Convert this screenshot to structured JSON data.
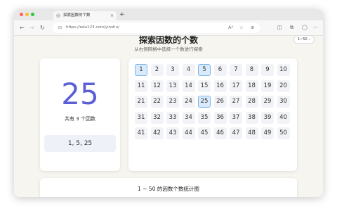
{
  "browser": {
    "tab_title": "探索因数的个数",
    "tab_close": "×",
    "new_tab": "+",
    "url": "https://edu123.com/yinshu/",
    "traffic_colors": [
      "#ff5f57",
      "#febc2e",
      "#28c840"
    ]
  },
  "header": {
    "title": "探索因数的个数",
    "subtitle": "从右侧网格中选择一个数进行探索",
    "range_label": "1~50"
  },
  "selected": {
    "number": "25",
    "count_text": "共有 3 个因数",
    "factors_text": "1, 5, 25",
    "accent": "#5b5fd6"
  },
  "grid": {
    "columns": 10,
    "numbers": [
      "1",
      "2",
      "3",
      "4",
      "5",
      "6",
      "7",
      "8",
      "9",
      "10",
      "11",
      "12",
      "13",
      "14",
      "15",
      "16",
      "17",
      "18",
      "19",
      "20",
      "21",
      "22",
      "23",
      "24",
      "25",
      "26",
      "27",
      "28",
      "29",
      "30",
      "31",
      "32",
      "33",
      "34",
      "35",
      "36",
      "37",
      "38",
      "39",
      "40",
      "41",
      "42",
      "43",
      "44",
      "45",
      "46",
      "47",
      "48",
      "49",
      "50"
    ],
    "highlighted": [
      "1",
      "5",
      "25"
    ]
  },
  "stats": {
    "title": "1 ~ 50 的因数个数统计图"
  }
}
